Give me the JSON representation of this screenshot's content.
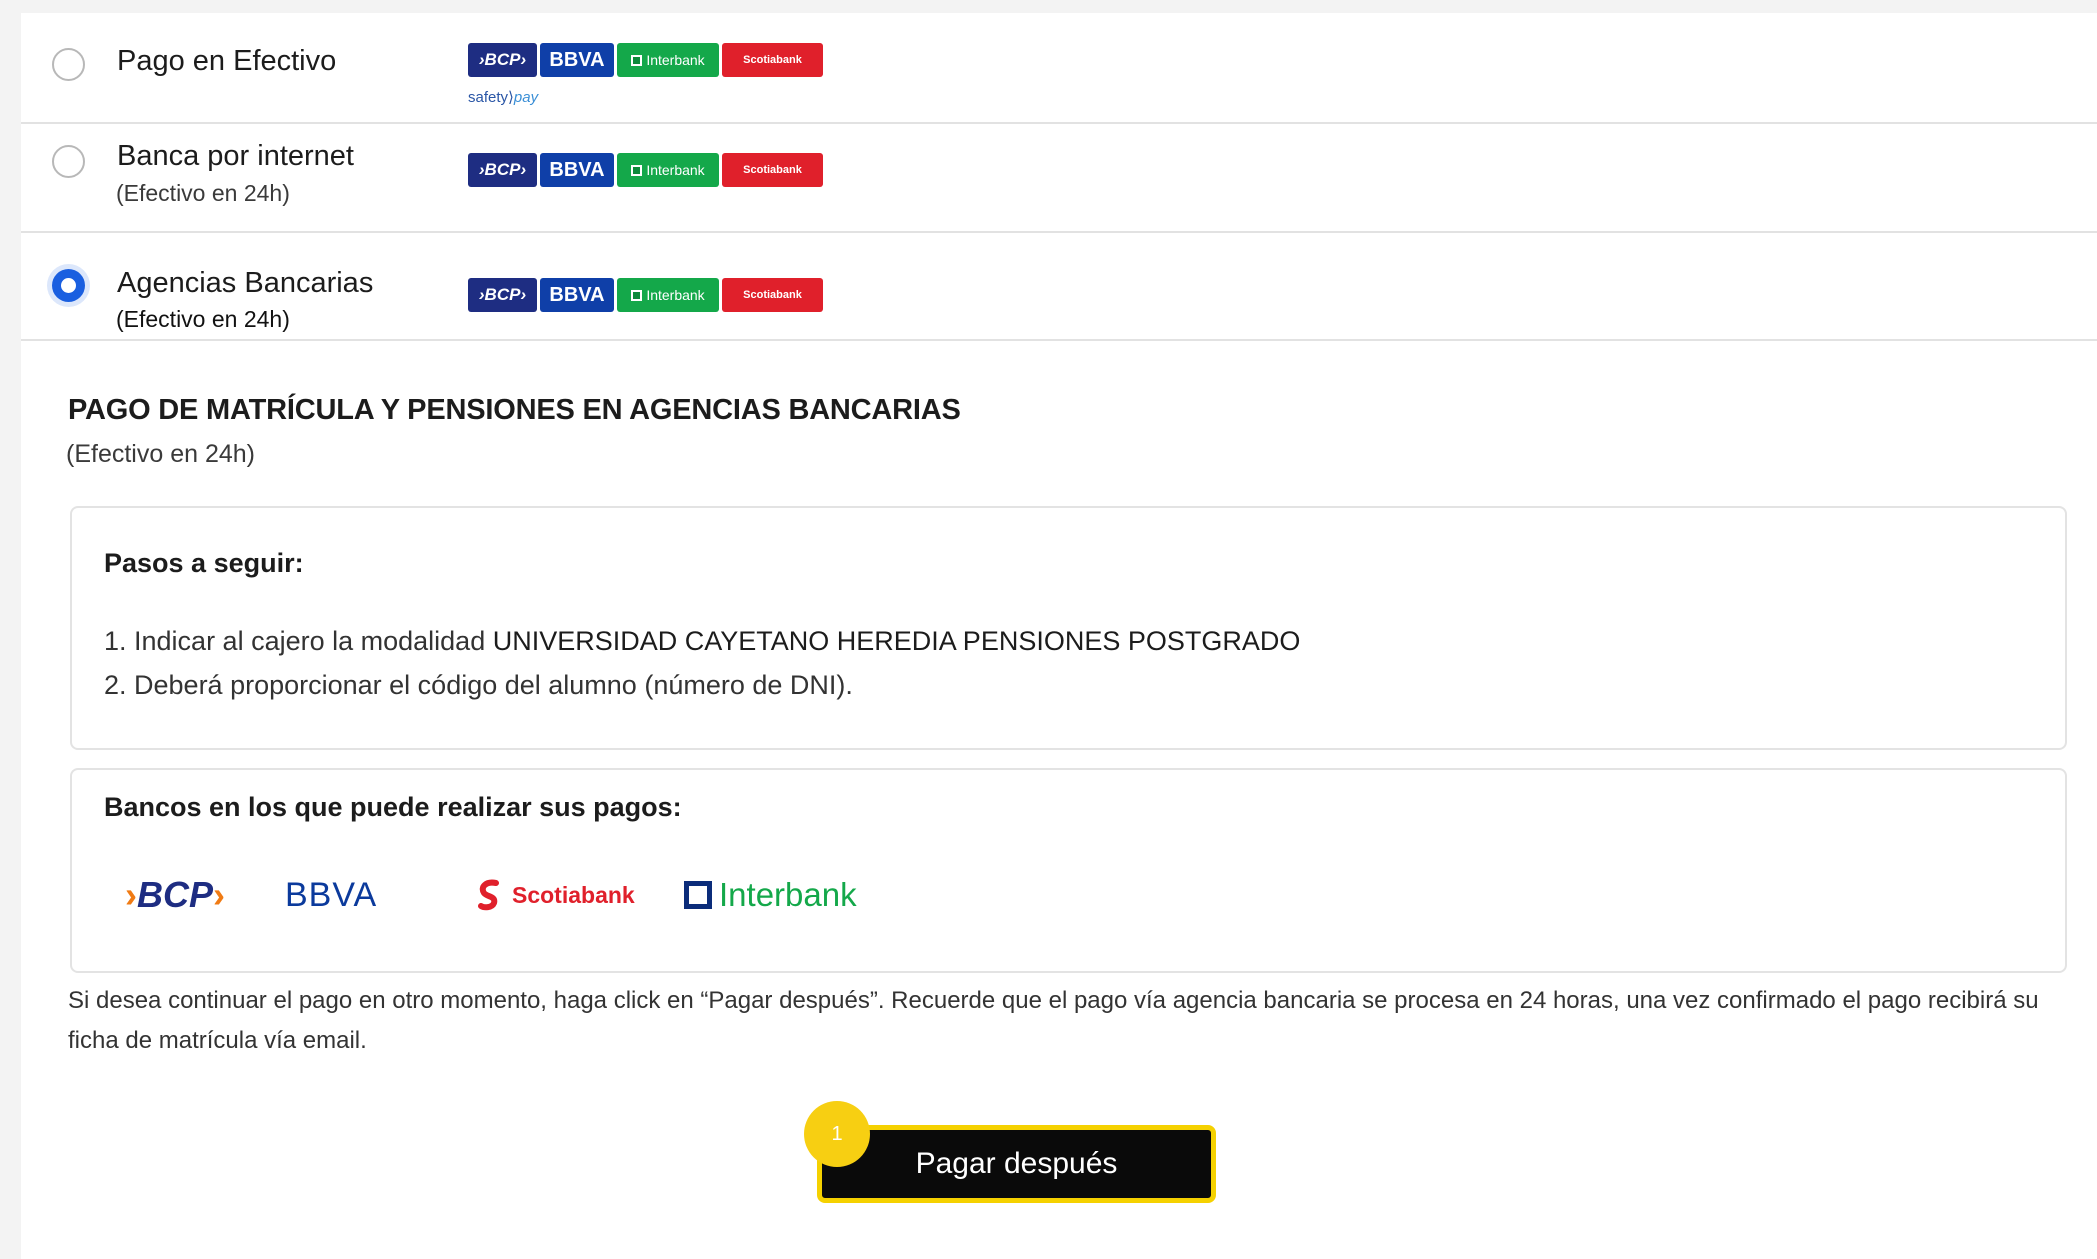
{
  "options": [
    {
      "title": "Pago en Efectivo",
      "subtitle": "",
      "selected": false,
      "logos": [
        "BCP",
        "BBVA",
        "Interbank",
        "Scotiabank"
      ],
      "extra": {
        "safety": "safety",
        "pay": "pay"
      }
    },
    {
      "title": "Banca por internet",
      "subtitle": "(Efectivo en 24h)",
      "selected": false,
      "logos": [
        "BCP",
        "BBVA",
        "Interbank",
        "Scotiabank"
      ]
    },
    {
      "title": "Agencias Bancarias",
      "subtitle": "(Efectivo en 24h)",
      "selected": true,
      "logos": [
        "BCP",
        "BBVA",
        "Interbank",
        "Scotiabank"
      ]
    }
  ],
  "logo_labels": {
    "bcp": "›BCP›",
    "bbva": "BBVA",
    "interbank": "Interbank",
    "scotiabank": "Scotiabank"
  },
  "section": {
    "title": "PAGO DE MATRÍCULA Y PENSIONES EN AGENCIAS BANCARIAS",
    "subtitle": "(Efectivo en 24h)"
  },
  "steps_box": {
    "title": "Pasos a seguir:",
    "steps": [
      {
        "prefix": "1. Indicar al cajero la modalidad ",
        "highlight": "UNIVERSIDAD CAYETANO HEREDIA PENSIONES POSTGRADO"
      },
      {
        "prefix": "2. Deberá proporcionar el código del alumno (número de DNI).",
        "highlight": ""
      }
    ]
  },
  "banks_box": {
    "title": "Bancos en los que puede realizar sus pagos:",
    "brands": {
      "bcp": "BCP",
      "bbva": "BBVA",
      "scotiabank": "Scotiabank",
      "interbank": "Interbank"
    }
  },
  "note": "Si desea continuar el pago en otro momento, haga click en “Pagar después”. Recuerde que el pago vía agencia bancaria se procesa en 24 horas, una vez confirmado el pago recibirá su ficha de matrícula vía email.",
  "button": {
    "label": "Pagar después",
    "badge": "1"
  },
  "colors": {
    "radio_selected": "#1a5fe0",
    "button_bg": "#0a0a0a",
    "button_border": "#f5d100",
    "badge": "#f7cf12",
    "bcp": "#1e2d82",
    "bbva": "#0f3fa8",
    "interbank": "#14a84a",
    "scotiabank": "#e0202b"
  }
}
